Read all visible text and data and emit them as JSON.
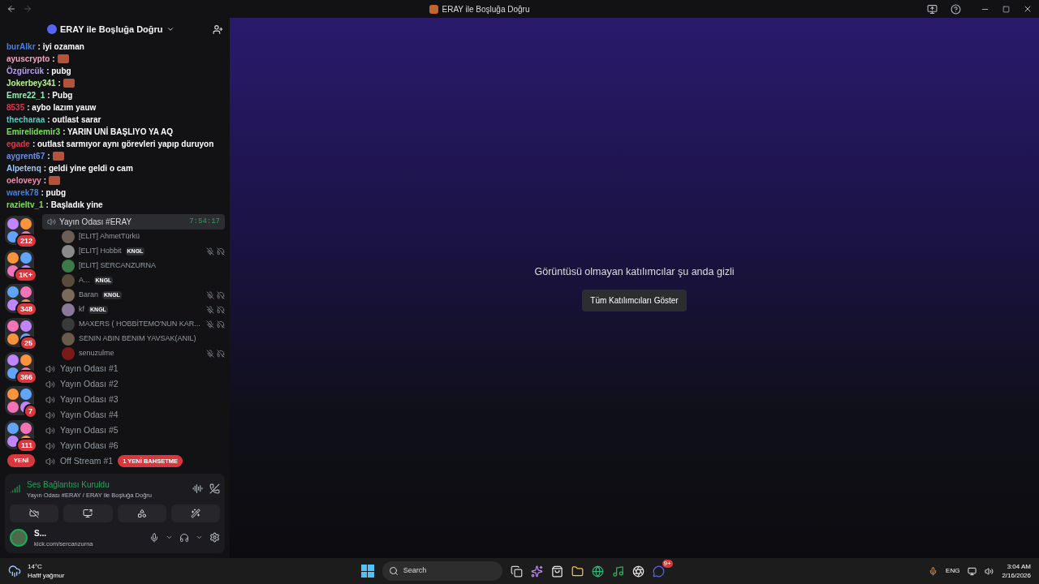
{
  "window": {
    "title": "ERAY ile Boşluğa Doğru"
  },
  "guild": {
    "name": "ERAY ile Boşluğa Doğru"
  },
  "chat": [
    {
      "user": "burAlkr",
      "color": "#4a7fe0",
      "text": ": iyi ozaman",
      "emote": false
    },
    {
      "user": "ayuscrypto",
      "color": "#f4a3c0",
      "text": ":",
      "emote": true
    },
    {
      "user": "Özgürcük",
      "color": "#b69cf5",
      "text": ": pubg",
      "emote": false
    },
    {
      "user": "Jokerbey341",
      "color": "#b6f58c",
      "text": ":",
      "emote": true
    },
    {
      "user": "Emre22_1",
      "color": "#8ef0b8",
      "text": ": Pubg",
      "emote": false
    },
    {
      "user": "8535",
      "color": "#e0364a",
      "text": ": aybo lazım yauw",
      "emote": false
    },
    {
      "user": "thecharaa",
      "color": "#4fd1c5",
      "text": ": outlast sarar",
      "emote": false
    },
    {
      "user": "Emirelidemir3",
      "color": "#7ee05a",
      "text": ": YARIN UNİ BAŞLIYO YA AQ",
      "emote": false
    },
    {
      "user": "egade",
      "color": "#e0364a",
      "text": ": outlast sarmıyor aynı görevleri yapıp duruyon",
      "emote": false
    },
    {
      "user": "aygrent67",
      "color": "#6b8fe8",
      "text": ":",
      "emote": true
    },
    {
      "user": "Alpetenq",
      "color": "#9cc9f5",
      "text": ": geldi yine geldi o cam",
      "emote": false
    },
    {
      "user": "oeloveyy",
      "color": "#f58cb0",
      "text": ":",
      "emote": true
    },
    {
      "user": "warek78",
      "color": "#4a7fe0",
      "text": ": pubg",
      "emote": false
    },
    {
      "user": "razieltv_1",
      "color": "#7ee05a",
      "text": ": Başladık yine",
      "emote": false
    }
  ],
  "active_voice": {
    "name": "Yayın Odası #ERAY",
    "time": "7:54:17"
  },
  "servers": [
    {
      "badge": "212"
    },
    {
      "badge": "1K+"
    },
    {
      "badge": "348"
    },
    {
      "badge": "25"
    },
    {
      "badge": "366"
    },
    {
      "badge": "7"
    },
    {
      "badge": "111"
    }
  ],
  "new_pill": "YENİ",
  "members": [
    {
      "name": "[ELIT] AhmetTürkü",
      "deafened": false
    },
    {
      "name": "[ELIT] Hobbit",
      "tag": "KNGL",
      "deafened": true
    },
    {
      "name": "[ELIT] SERCANZURNA",
      "deafened": false
    },
    {
      "name": "A...",
      "tag": "KNGL",
      "deafened": false
    },
    {
      "name": "Baran",
      "tag": "KNGL",
      "deafened": true
    },
    {
      "name": "kf",
      "tag": "KNGL",
      "deafened": true
    },
    {
      "name": "MAXERS ( HOBBİTEMO'NUN KAR...",
      "deafened": true
    },
    {
      "name": "SENIN ABIN BENIM YAVSAK(ANIL)",
      "deafened": false
    },
    {
      "name": "senuzulme",
      "deafened": true
    }
  ],
  "channels": [
    "Yayın Odası #1",
    "Yayın Odası #2",
    "Yayın Odası #3",
    "Yayın Odası #4",
    "Yayın Odası #5",
    "Yayın Odası #6",
    "Off Stream #1"
  ],
  "mention_pill": "1 YENİ BAHSETME",
  "voice_panel": {
    "status": "Ses Bağlantısı Kuruldu",
    "location": "Yayın Odası #ERAY / ERAY ile Boşluğa Doğru"
  },
  "user_panel": {
    "name": "S...",
    "status": "kick.com/sercanzurna"
  },
  "main": {
    "message": "Görüntüsü olmayan katılımcılar şu anda gizli",
    "button": "Tüm Katılımcıları Göster"
  },
  "taskbar": {
    "temp": "14°C",
    "weather": "Hafif yağmur",
    "search_placeholder": "Search",
    "discord_badge": "9+",
    "lang": "ENG",
    "time": "3:04 AM",
    "date": "2/16/2026"
  }
}
